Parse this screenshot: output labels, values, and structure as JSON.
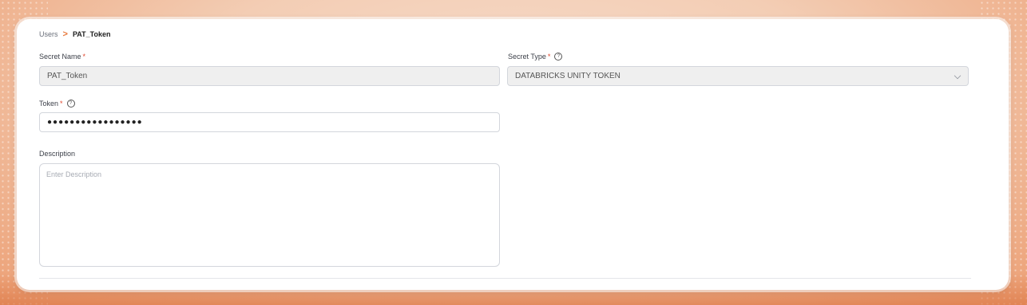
{
  "breadcrumb": {
    "parent": "Users",
    "separator": ">",
    "current": "PAT_Token"
  },
  "form": {
    "secret_name": {
      "label": "Secret Name",
      "required_mark": "*",
      "value": "PAT_Token"
    },
    "secret_type": {
      "label": "Secret Type",
      "required_mark": "*",
      "help_icon": "?",
      "value": "DATABRICKS UNITY TOKEN"
    },
    "token": {
      "label": "Token",
      "required_mark": "*",
      "help_icon": "?",
      "masked_value": "●●●●●●●●●●●●●●●●●"
    },
    "description": {
      "label": "Description",
      "placeholder": "Enter Description"
    }
  },
  "colors": {
    "accent": "#e8783b",
    "required": "#e0452b"
  }
}
